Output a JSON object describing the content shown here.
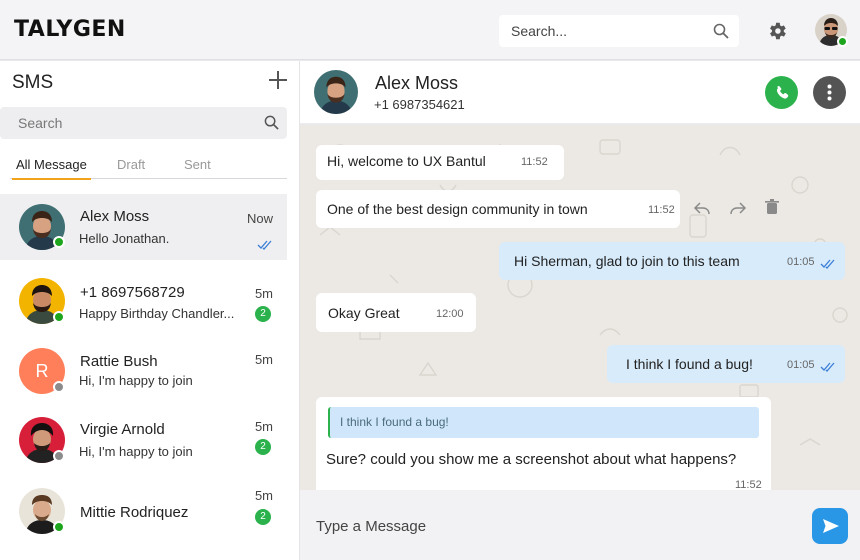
{
  "header": {
    "logo_text": "TALYGEN",
    "search_placeholder": "Search...",
    "icons": {
      "search": "search-icon",
      "settings": "gear-icon",
      "user": "avatar"
    }
  },
  "sidebar": {
    "title": "SMS",
    "search_placeholder": "Search",
    "tabs": [
      "All Message",
      "Draft",
      "Sent"
    ],
    "active_tab": "All Message",
    "conversations": [
      {
        "name": "Alex Moss",
        "message": "Hello Jonathan.",
        "time": "Now",
        "status": "online",
        "read": true
      },
      {
        "name": "+1 8697568729",
        "message": "Happy Birthday Chandler...",
        "time": "5m",
        "unread": "2",
        "status": "online"
      },
      {
        "name": "Rattie Bush",
        "message": "Hi, I'm happy to join",
        "time": "5m",
        "initial": "R",
        "status": "offline"
      },
      {
        "name": "Virgie Arnold",
        "message": "Hi, I'm happy to join",
        "time": "5m",
        "unread": "2",
        "status": "offline"
      },
      {
        "name": "Mittie Rodriquez",
        "message": "",
        "time": "5m",
        "unread": "2",
        "status": "online"
      }
    ]
  },
  "chat": {
    "contact_name": "Alex Moss",
    "contact_phone": "+1 6987354621",
    "messages": [
      {
        "direction": "in",
        "text": "Hi, welcome to UX Bantul",
        "time": "11:52"
      },
      {
        "direction": "in",
        "text": "One of the best design community in town",
        "time": "11:52",
        "actions": [
          "reply-icon",
          "forward-icon",
          "trash-icon"
        ]
      },
      {
        "direction": "out",
        "text": "Hi Sherman, glad to join to this team",
        "time": "01:05",
        "read": true
      },
      {
        "direction": "in",
        "text": "Okay Great",
        "time": "12:00"
      },
      {
        "direction": "out",
        "text": "I think I found a bug!",
        "time": "01:05",
        "read": true
      },
      {
        "direction": "in",
        "quote": "I think I found a bug!",
        "text": "Sure? could you show me a screenshot about what happens?",
        "time": "11:52"
      }
    ],
    "composer_placeholder": "Type a Message"
  },
  "colors": {
    "accent": "#f1a41b",
    "online": "#1ea51e",
    "call": "#2bb24c",
    "send": "#2996e6",
    "outgoing_bubble": "#d7ebfb",
    "chat_bg": "#ece9e4"
  }
}
